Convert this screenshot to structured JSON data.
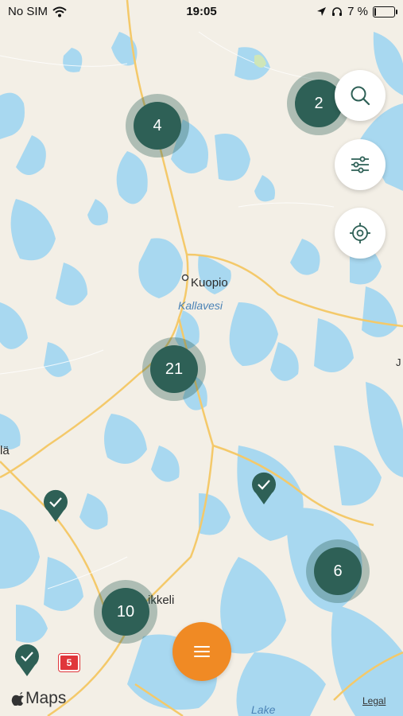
{
  "status_bar": {
    "carrier": "No SIM",
    "time": "19:05",
    "battery_percent": "7 %",
    "battery_level": 0.07
  },
  "map": {
    "city_label": "Kuopio",
    "lake_label_1": "Kallavesi",
    "city_label_partial_left": "lä",
    "city_label_partial_bottom": "ikkeli",
    "lake_label_bottom": "Lake",
    "edge_letter": "J",
    "route_number": "5"
  },
  "clusters": [
    {
      "count": "4"
    },
    {
      "count": "2"
    },
    {
      "count": "21"
    },
    {
      "count": "6"
    },
    {
      "count": "10"
    }
  ],
  "controls": {
    "search_icon": "search-icon",
    "filter_icon": "sliders-icon",
    "locate_icon": "location-target-icon"
  },
  "attribution": {
    "brand": "Maps",
    "legal": "Legal"
  },
  "colors": {
    "accent": "#f08a24",
    "cluster": "#2e6056",
    "water": "#a8d8f0",
    "land": "#f3efe6",
    "road": "#f4c96a"
  }
}
